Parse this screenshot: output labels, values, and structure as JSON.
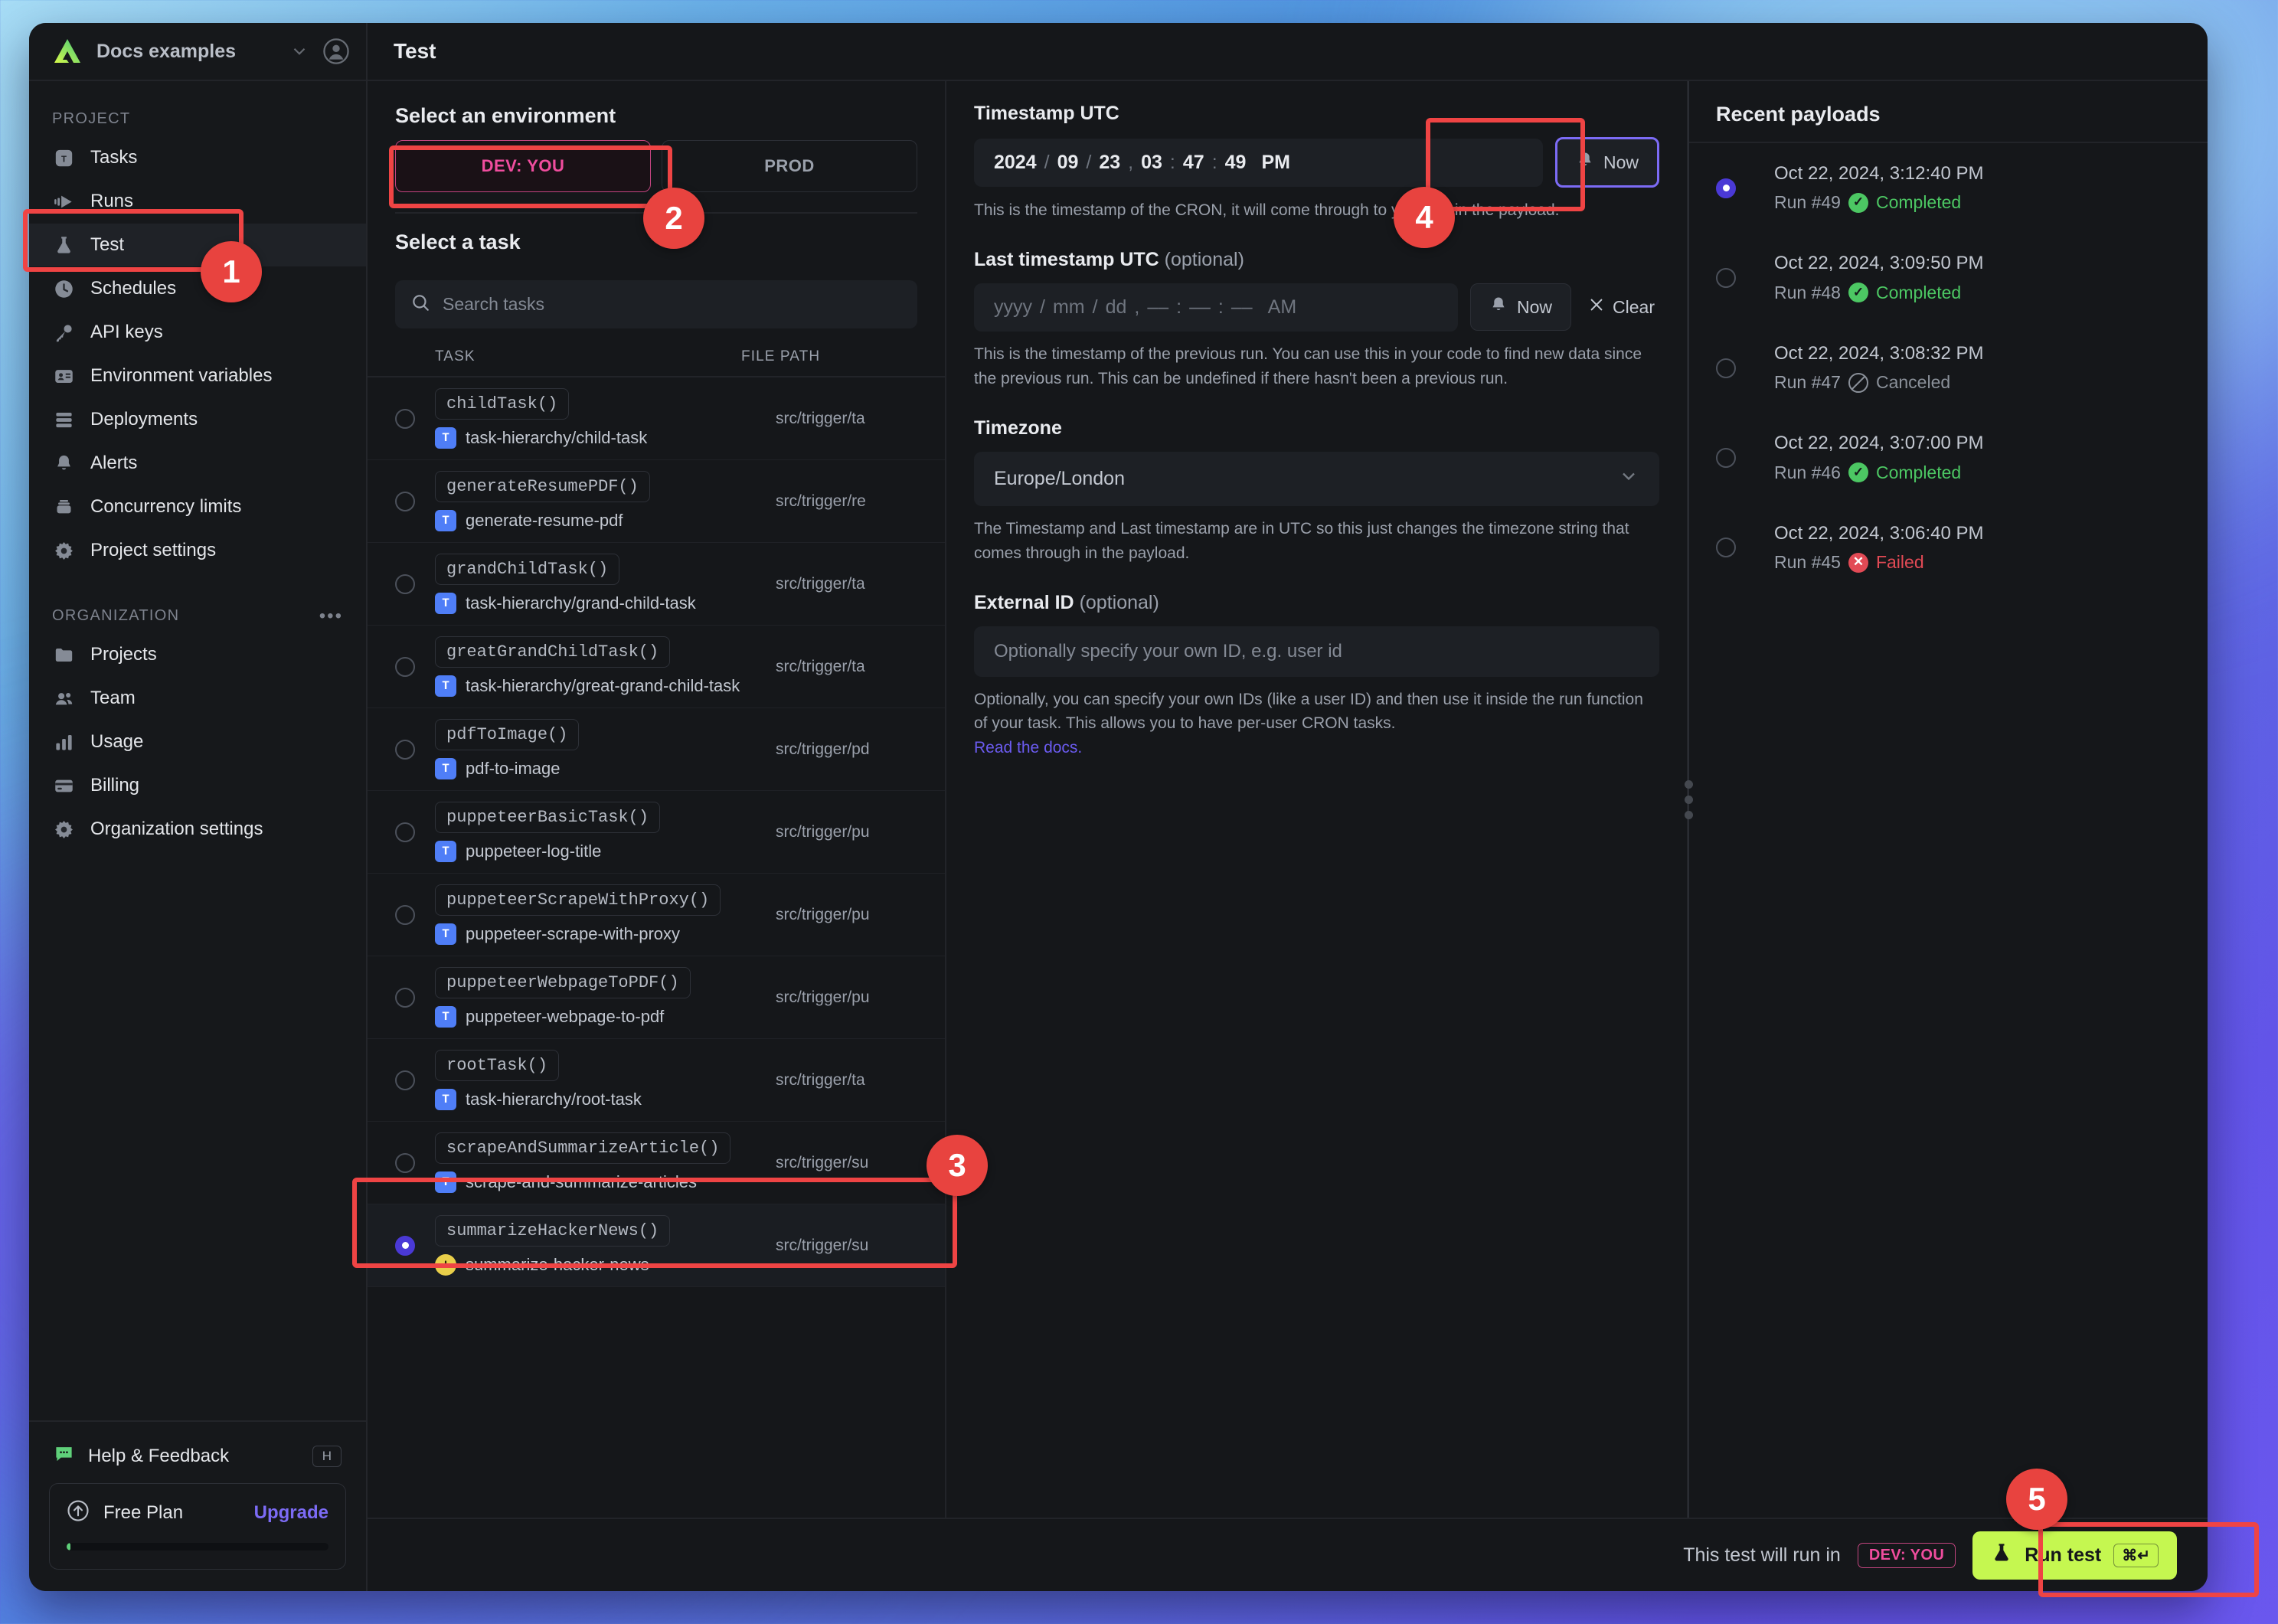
{
  "sidebar": {
    "org_name": "Docs examples",
    "sections": [
      {
        "label": "PROJECT",
        "items": [
          {
            "label": "Tasks",
            "icon": "tasks-icon"
          },
          {
            "label": "Runs",
            "icon": "runs-icon"
          },
          {
            "label": "Test",
            "icon": "flask-icon",
            "active": true
          },
          {
            "label": "Schedules",
            "icon": "clock-icon"
          },
          {
            "label": "API keys",
            "icon": "key-icon"
          },
          {
            "label": "Environment variables",
            "icon": "id-card-icon"
          },
          {
            "label": "Deployments",
            "icon": "server-icon"
          },
          {
            "label": "Alerts",
            "icon": "bell-icon"
          },
          {
            "label": "Concurrency limits",
            "icon": "stack-icon"
          },
          {
            "label": "Project settings",
            "icon": "gear-icon"
          }
        ]
      },
      {
        "label": "ORGANIZATION",
        "items": [
          {
            "label": "Projects",
            "icon": "folder-icon"
          },
          {
            "label": "Team",
            "icon": "people-icon"
          },
          {
            "label": "Usage",
            "icon": "bar-chart-icon"
          },
          {
            "label": "Billing",
            "icon": "credit-card-icon"
          },
          {
            "label": "Organization settings",
            "icon": "gear-icon"
          }
        ]
      }
    ],
    "help": {
      "label": "Help & Feedback",
      "shortcut": "H"
    },
    "plan": {
      "name": "Free Plan",
      "upgrade": "Upgrade",
      "progress_percent": 1
    }
  },
  "header": {
    "title": "Test"
  },
  "environment": {
    "title": "Select an environment",
    "tabs": [
      {
        "label": "DEV: YOU",
        "selected": true
      },
      {
        "label": "PROD",
        "selected": false
      }
    ]
  },
  "tasks_panel": {
    "title": "Select a task",
    "search_placeholder": "Search tasks",
    "search_value": "",
    "columns": {
      "task": "TASK",
      "file_path": "FILE PATH"
    },
    "rows": [
      {
        "fn": "childTask()",
        "slug": "task-hierarchy/child-task",
        "badge": "T",
        "badge_kind": "task",
        "path": "src/trigger/ta",
        "selected": false
      },
      {
        "fn": "generateResumePDF()",
        "slug": "generate-resume-pdf",
        "badge": "T",
        "badge_kind": "task",
        "path": "src/trigger/re",
        "selected": false
      },
      {
        "fn": "grandChildTask()",
        "slug": "task-hierarchy/grand-child-task",
        "badge": "T",
        "badge_kind": "task",
        "path": "src/trigger/ta",
        "selected": false
      },
      {
        "fn": "greatGrandChildTask()",
        "slug": "task-hierarchy/great-grand-child-task",
        "badge": "T",
        "badge_kind": "task",
        "path": "src/trigger/ta",
        "selected": false
      },
      {
        "fn": "pdfToImage()",
        "slug": "pdf-to-image",
        "badge": "T",
        "badge_kind": "task",
        "path": "src/trigger/pd",
        "selected": false
      },
      {
        "fn": "puppeteerBasicTask()",
        "slug": "puppeteer-log-title",
        "badge": "T",
        "badge_kind": "task",
        "path": "src/trigger/pu",
        "selected": false
      },
      {
        "fn": "puppeteerScrapeWithProxy()",
        "slug": "puppeteer-scrape-with-proxy",
        "badge": "T",
        "badge_kind": "task",
        "path": "src/trigger/pu",
        "selected": false
      },
      {
        "fn": "puppeteerWebpageToPDF()",
        "slug": "puppeteer-webpage-to-pdf",
        "badge": "T",
        "badge_kind": "task",
        "path": "src/trigger/pu",
        "selected": false
      },
      {
        "fn": "rootTask()",
        "slug": "task-hierarchy/root-task",
        "badge": "T",
        "badge_kind": "task",
        "path": "src/trigger/ta",
        "selected": false
      },
      {
        "fn": "scrapeAndSummarizeArticle()",
        "slug": "scrape-and-summarize-articles",
        "badge": "T",
        "badge_kind": "task",
        "path": "src/trigger/su",
        "selected": false
      },
      {
        "fn": "summarizeHackerNews()",
        "slug": "summarize-hacker-news",
        "badge": "",
        "badge_kind": "schedule",
        "path": "src/trigger/su",
        "selected": true
      }
    ]
  },
  "form": {
    "timestamp": {
      "label": "Timestamp UTC",
      "year": "2024",
      "month": "09",
      "day": "23",
      "hour": "03",
      "minute": "47",
      "second": "49",
      "meridiem": "PM",
      "now_label": "Now",
      "help": "This is the timestamp of the CRON, it will come through to your run in the payload."
    },
    "last_timestamp": {
      "label": "Last timestamp UTC",
      "optional": "(optional)",
      "year": "yyyy",
      "month": "mm",
      "day": "dd",
      "hour": "––",
      "minute": "––",
      "second": "––",
      "meridiem": "AM",
      "now_label": "Now",
      "clear_label": "Clear",
      "help": "This is the timestamp of the previous run. You can use this in your code to find new data since the previous run. This can be undefined if there hasn't been a previous run."
    },
    "timezone": {
      "label": "Timezone",
      "value": "Europe/London",
      "help": "The Timestamp and Last timestamp are in UTC so this just changes the timezone string that comes through in the payload."
    },
    "external_id": {
      "label": "External ID",
      "optional": "(optional)",
      "placeholder": "Optionally specify your own ID, e.g. user id",
      "value": "",
      "help": "Optionally, you can specify your own IDs (like a user ID) and then use it inside the run function of your task. This allows you to have per-user CRON tasks.",
      "link": "Read the docs."
    }
  },
  "payloads": {
    "title": "Recent payloads",
    "items": [
      {
        "date": "Oct 22, 2024, 3:12:40 PM",
        "run": "Run #49",
        "status": "Completed",
        "status_kind": "completed",
        "selected": true
      },
      {
        "date": "Oct 22, 2024, 3:09:50 PM",
        "run": "Run #48",
        "status": "Completed",
        "status_kind": "completed",
        "selected": false
      },
      {
        "date": "Oct 22, 2024, 3:08:32 PM",
        "run": "Run #47",
        "status": "Canceled",
        "status_kind": "canceled",
        "selected": false
      },
      {
        "date": "Oct 22, 2024, 3:07:00 PM",
        "run": "Run #46",
        "status": "Completed",
        "status_kind": "completed",
        "selected": false
      },
      {
        "date": "Oct 22, 2024, 3:06:40 PM",
        "run": "Run #45",
        "status": "Failed",
        "status_kind": "failed",
        "selected": false
      }
    ]
  },
  "footer": {
    "note": "This test will run in",
    "env_pill": "DEV: YOU",
    "run_label": "Run test",
    "run_shortcut": "⌘↵"
  },
  "annotations": {
    "badges": [
      "1",
      "2",
      "3",
      "4",
      "5"
    ]
  },
  "colors": {
    "accent_green": "#c5f750",
    "accent_pink": "#f04d9e",
    "accent_purple": "#7c6bf5",
    "status_completed": "#4cc763",
    "status_failed": "#e24a55",
    "status_canceled": "#8a9099",
    "annotation_red": "#ef4444"
  }
}
